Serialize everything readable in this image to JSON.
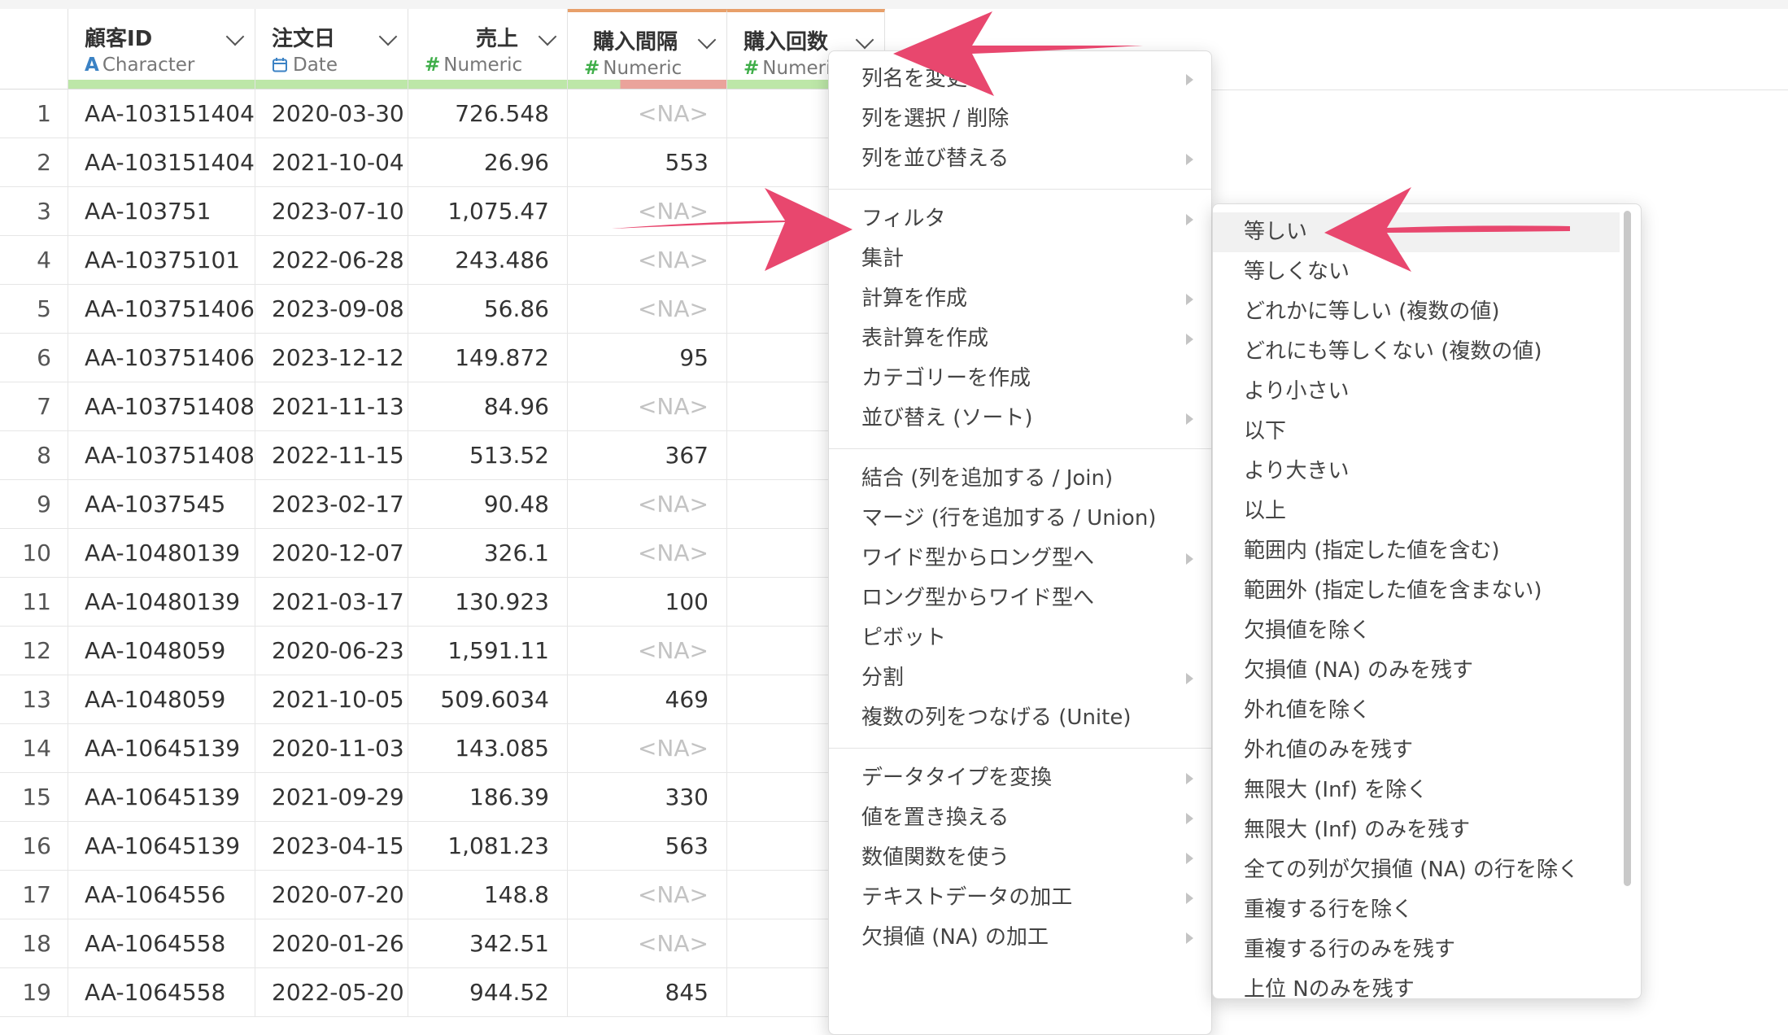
{
  "columns": [
    {
      "name": "顧客ID",
      "type": "Character",
      "type_icon": "A"
    },
    {
      "name": "注文日",
      "type": "Date",
      "type_icon": "calendar-icon"
    },
    {
      "name": "売上",
      "type": "Numeric",
      "type_icon": "#"
    },
    {
      "name": "購入間隔",
      "type": "Numeric",
      "type_icon": "#"
    },
    {
      "name": "購入回数",
      "type": "Numeric",
      "type_icon": "#",
      "type_truncated": "Numeri"
    }
  ],
  "rows": [
    {
      "n": "1",
      "id": "AA-103151404",
      "date": "2020-03-30",
      "sales": "726.548",
      "interval": "<NA>"
    },
    {
      "n": "2",
      "id": "AA-103151404",
      "date": "2021-10-04",
      "sales": "26.96",
      "interval": "553"
    },
    {
      "n": "3",
      "id": "AA-103751",
      "date": "2023-07-10",
      "sales": "1,075.47",
      "interval": "<NA>"
    },
    {
      "n": "4",
      "id": "AA-10375101",
      "date": "2022-06-28",
      "sales": "243.486",
      "interval": "<NA>"
    },
    {
      "n": "5",
      "id": "AA-103751406",
      "date": "2023-09-08",
      "sales": "56.86",
      "interval": "<NA>"
    },
    {
      "n": "6",
      "id": "AA-103751406",
      "date": "2023-12-12",
      "sales": "149.872",
      "interval": "95"
    },
    {
      "n": "7",
      "id": "AA-103751408",
      "date": "2021-11-13",
      "sales": "84.96",
      "interval": "<NA>"
    },
    {
      "n": "8",
      "id": "AA-103751408",
      "date": "2022-11-15",
      "sales": "513.52",
      "interval": "367"
    },
    {
      "n": "9",
      "id": "AA-1037545",
      "date": "2023-02-17",
      "sales": "90.48",
      "interval": "<NA>"
    },
    {
      "n": "10",
      "id": "AA-10480139",
      "date": "2020-12-07",
      "sales": "326.1",
      "interval": "<NA>"
    },
    {
      "n": "11",
      "id": "AA-10480139",
      "date": "2021-03-17",
      "sales": "130.923",
      "interval": "100"
    },
    {
      "n": "12",
      "id": "AA-1048059",
      "date": "2020-06-23",
      "sales": "1,591.11",
      "interval": "<NA>"
    },
    {
      "n": "13",
      "id": "AA-1048059",
      "date": "2021-10-05",
      "sales": "509.6034",
      "interval": "469"
    },
    {
      "n": "14",
      "id": "AA-10645139",
      "date": "2020-11-03",
      "sales": "143.085",
      "interval": "<NA>"
    },
    {
      "n": "15",
      "id": "AA-10645139",
      "date": "2021-09-29",
      "sales": "186.39",
      "interval": "330"
    },
    {
      "n": "16",
      "id": "AA-10645139",
      "date": "2023-04-15",
      "sales": "1,081.23",
      "interval": "563"
    },
    {
      "n": "17",
      "id": "AA-1064556",
      "date": "2020-07-20",
      "sales": "148.8",
      "interval": "<NA>"
    },
    {
      "n": "18",
      "id": "AA-1064558",
      "date": "2020-01-26",
      "sales": "342.51",
      "interval": "<NA>"
    },
    {
      "n": "19",
      "id": "AA-1064558",
      "date": "2022-05-20",
      "sales": "944.52",
      "interval": "845"
    }
  ],
  "context_menu": {
    "groups": [
      [
        {
          "label": "列名を変更",
          "submenu": true
        },
        {
          "label": "列を選択 / 削除",
          "submenu": false
        },
        {
          "label": "列を並び替える",
          "submenu": true
        }
      ],
      [
        {
          "label": "フィルタ",
          "submenu": true
        },
        {
          "label": "集計",
          "submenu": false
        },
        {
          "label": "計算を作成",
          "submenu": true
        },
        {
          "label": "表計算を作成",
          "submenu": true
        },
        {
          "label": "カテゴリーを作成",
          "submenu": false
        },
        {
          "label": "並び替え (ソート)",
          "submenu": true
        }
      ],
      [
        {
          "label": "結合 (列を追加する / Join)",
          "submenu": false
        },
        {
          "label": "マージ (行を追加する / Union)",
          "submenu": false
        },
        {
          "label": "ワイド型からロング型へ",
          "submenu": true
        },
        {
          "label": "ロング型からワイド型へ",
          "submenu": false
        },
        {
          "label": "ピボット",
          "submenu": false
        },
        {
          "label": "分割",
          "submenu": true
        },
        {
          "label": "複数の列をつなげる (Unite)",
          "submenu": false
        }
      ],
      [
        {
          "label": "データタイプを変換",
          "submenu": true
        },
        {
          "label": "値を置き換える",
          "submenu": true
        },
        {
          "label": "数値関数を使う",
          "submenu": true
        },
        {
          "label": "テキストデータの加工",
          "submenu": true
        },
        {
          "label": "欠損値 (NA) の加工",
          "submenu": true
        }
      ]
    ]
  },
  "filter_submenu": [
    "等しい",
    "等しくない",
    "どれかに等しい (複数の値)",
    "どれにも等しくない (複数の値)",
    "より小さい",
    "以下",
    "より大きい",
    "以上",
    "範囲内 (指定した値を含む)",
    "範囲外 (指定した値を含まない)",
    "欠損値を除く",
    "欠損値 (NA) のみを残す",
    "外れ値を除く",
    "外れ値のみを残す",
    "無限大 (Inf) を除く",
    "無限大 (Inf) のみを残す",
    "全ての列が欠損値 (NA) の行を除く",
    "重複する行を除く",
    "重複する行のみを残す",
    "上位 Nのみを残す"
  ],
  "colors": {
    "accent_arrow": "#e8476e",
    "header_quality_ok": "#bde7a8",
    "header_quality_missing": "#eaa39b",
    "selected_column_top": "#e8a06a"
  }
}
